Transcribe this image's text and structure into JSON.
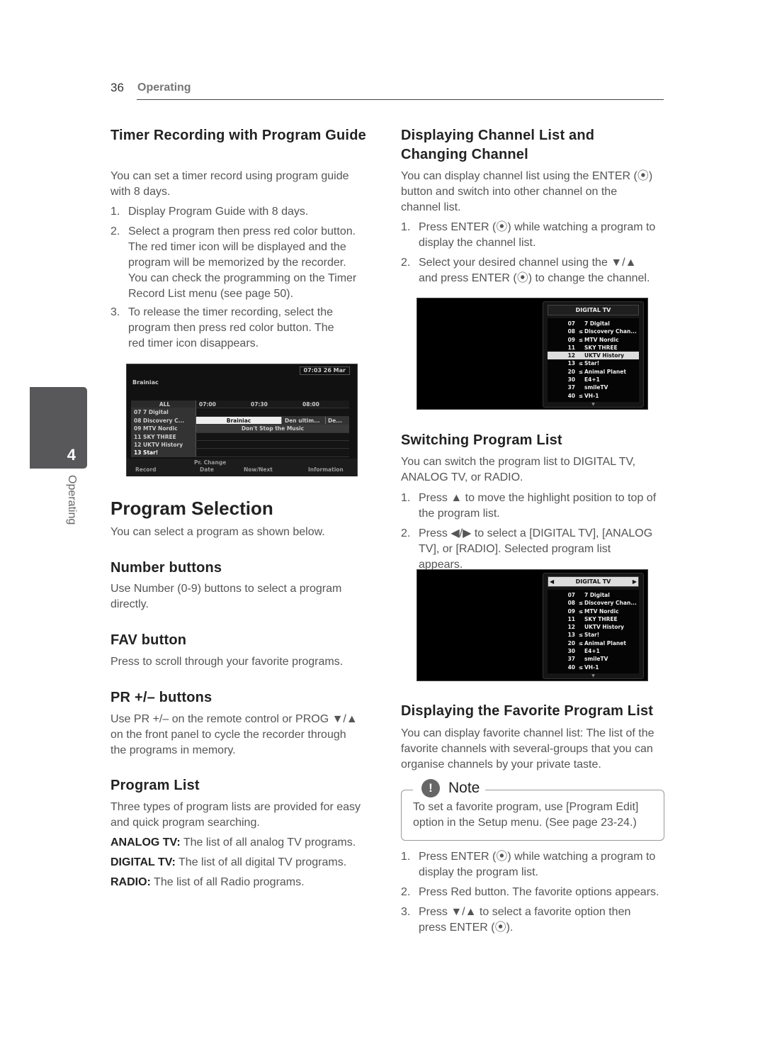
{
  "header": {
    "page_number": "36",
    "section": "Operating"
  },
  "side_tab": {
    "chapter": "4",
    "label": "Operating"
  },
  "timer": {
    "title": "Timer Recording with Program Guide",
    "intro": "You can set a timer record using program guide with 8 days.",
    "steps": [
      {
        "n": "1.",
        "text": "Display Program Guide with 8 days."
      },
      {
        "n": "2.",
        "text": "Select a program then press red color button. The red timer icon will be displayed and the program will be memorized by the recorder. You can check the programming on the Timer Record List menu (see page 50)."
      },
      {
        "n": "3.",
        "text": "To release the timer recording, select the program then press red color button. The red timer icon disappears."
      }
    ]
  },
  "guide": {
    "clock": "07:03  26 Mar",
    "program": "Brainiac",
    "filter": "ALL",
    "times": [
      "07:00",
      "07:30",
      "08:00"
    ],
    "channels": [
      "07 7 Digital",
      "08 Discovery C...",
      "09 MTV Nordic",
      "11 SKY THREE",
      "12 UKTV History",
      "13 Star!"
    ],
    "row08": [
      "Brainiac",
      "Den ultim...",
      "De..."
    ],
    "row09": "Don't Stop the Music",
    "pr_change": "Pr. Change",
    "keys": [
      "Record",
      "Date",
      "Now/Next",
      "Information"
    ]
  },
  "program_selection": {
    "title": "Program Selection",
    "intro": "You can select a program as shown below.",
    "number": {
      "title": "Number buttons",
      "text": "Use Number (0-9) buttons to select a program directly."
    },
    "fav": {
      "title": "FAV button",
      "text": "Press to scroll through your favorite programs."
    },
    "pr": {
      "title": "PR +/– buttons",
      "text": "Use PR +/– on the remote control or PROG ▼/▲ on the front panel to cycle the recorder through the programs in memory."
    },
    "list": {
      "title": "Program List",
      "text": "Three types of program lists are provided for easy and quick program searching.",
      "defs": [
        {
          "term": "ANALOG TV:",
          "desc": " The list of all analog TV programs."
        },
        {
          "term": "DIGITAL TV:",
          "desc": " The list of all digital TV programs."
        },
        {
          "term": "RADIO:",
          "desc": " The list of all Radio programs."
        }
      ]
    }
  },
  "channel_list": {
    "title": "Displaying Channel List and Changing Channel",
    "intro": "You can display channel list using the ENTER (⦿) button and switch into other channel on the channel list.",
    "steps": [
      {
        "n": "1.",
        "text": "Press ENTER (⦿) while watching a program to display the channel list."
      },
      {
        "n": "2.",
        "text": " Select your desired channel using the ▼/▲ and press ENTER (⦿) to change the channel."
      }
    ]
  },
  "osd": {
    "title": "DIGITAL TV",
    "channels": [
      {
        "num": "07",
        "fav": "",
        "name": "7 Digital"
      },
      {
        "num": "08",
        "fav": "≤",
        "name": "Discovery Chan..."
      },
      {
        "num": "09",
        "fav": "≤",
        "name": "MTV Nordic"
      },
      {
        "num": "11",
        "fav": "",
        "name": "SKY THREE"
      },
      {
        "num": "12",
        "fav": "",
        "name": "UKTV History"
      },
      {
        "num": "13",
        "fav": "≤",
        "name": "Star!"
      },
      {
        "num": "20",
        "fav": "≤",
        "name": "Animal Planet"
      },
      {
        "num": "30",
        "fav": "",
        "name": "E4+1"
      },
      {
        "num": "37",
        "fav": "",
        "name": "smileTV"
      },
      {
        "num": "40",
        "fav": "≤",
        "name": "VH-1"
      }
    ],
    "highlighted": "12"
  },
  "switching": {
    "title": "Switching Program List",
    "intro": "You can switch the program list to DIGITAL TV, ANALOG TV, or RADIO.",
    "steps": [
      {
        "n": "1.",
        "text": "Press ▲ to move the highlight position to top of the program list."
      },
      {
        "n": "2.",
        "text": "Press ◀/▶ to select a [DIGITAL TV], [ANALOG TV], or [RADIO]. Selected program list appears."
      }
    ]
  },
  "favorite": {
    "title": "Displaying the Favorite Program List",
    "intro": "You can display favorite channel list: The list of the favorite channels with several-groups that you can organise channels by your private taste.",
    "note_title": "Note",
    "note_text": "To set a favorite program, use [Program Edit] option in the Setup menu. (See page 23-24.)",
    "steps": [
      {
        "n": "1.",
        "text": "Press ENTER (⦿) while watching a program to display the program list."
      },
      {
        "n": "2.",
        "text": "Press Red button. The favorite options appears."
      },
      {
        "n": "3.",
        "text": "Press ▼/▲ to select a favorite option then press ENTER (⦿)."
      }
    ]
  }
}
